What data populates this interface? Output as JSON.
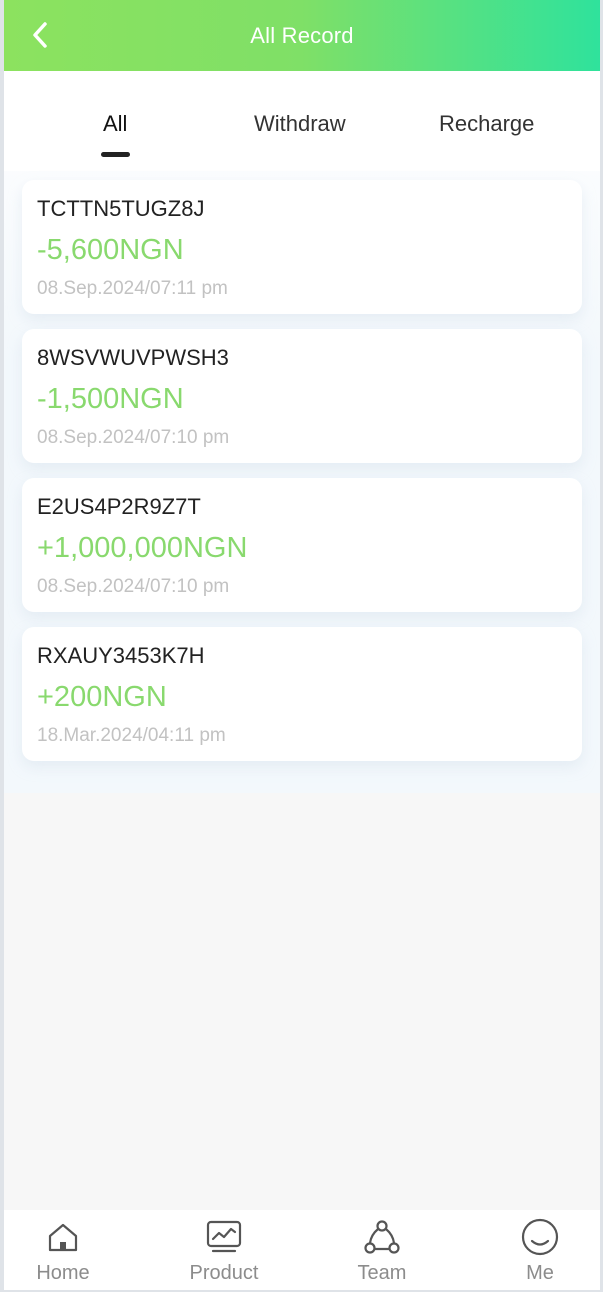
{
  "header": {
    "title": "All Record",
    "gradient": [
      "#8ce25f",
      "#2fe29c"
    ]
  },
  "tabs": [
    {
      "label": "All",
      "active": true
    },
    {
      "label": "Withdraw",
      "active": false
    },
    {
      "label": "Recharge",
      "active": false
    }
  ],
  "records": [
    {
      "id": "TCTTN5TUGZ8J",
      "amount": "-5,600NGN",
      "date": "08.Sep.2024/07:11 pm"
    },
    {
      "id": "8WSVWUVPWSH3",
      "amount": "-1,500NGN",
      "date": "08.Sep.2024/07:10 pm"
    },
    {
      "id": "E2US4P2R9Z7T",
      "amount": "+1,000,000NGN",
      "date": "08.Sep.2024/07:10 pm"
    },
    {
      "id": "RXAUY3453K7H",
      "amount": "+200NGN",
      "date": "18.Mar.2024/04:11 pm"
    }
  ],
  "bottom_nav": [
    {
      "label": "Home",
      "icon": "home-icon"
    },
    {
      "label": "Product",
      "icon": "chart-icon"
    },
    {
      "label": "Team",
      "icon": "team-icon"
    },
    {
      "label": "Me",
      "icon": "smile-icon"
    }
  ],
  "colors": {
    "amount": "#89d96e",
    "date": "#c2c2c2",
    "nav_label": "#8c8c8c"
  }
}
